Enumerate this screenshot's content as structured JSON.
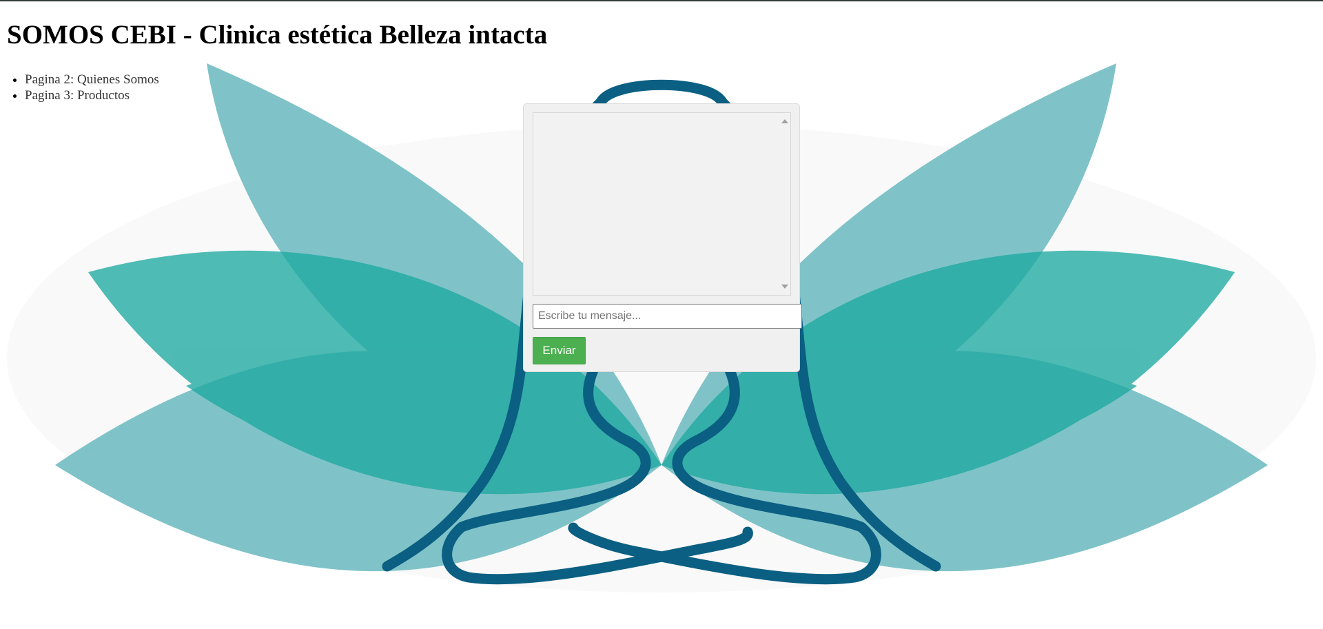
{
  "header": {
    "title": "SOMOS CEBI - Clinica estética Belleza intacta"
  },
  "nav": {
    "items": [
      {
        "label": "Pagina 2: Quienes Somos"
      },
      {
        "label": "Pagina 3: Productos"
      }
    ]
  },
  "chat": {
    "log_text": "",
    "input_value": "",
    "input_placeholder": "Escribe tu mensaje...",
    "send_label": "Enviar"
  },
  "background": {
    "logo_icon": "lotus-meditation-logo-icon",
    "colors": {
      "petal_light": "#7fc3c8",
      "petal_mid": "#1ea9a0",
      "figure_line": "#0a5f82",
      "glow": "#f4f4f4",
      "top_rule": "#2f3d3a",
      "send_button": "#4caf50"
    }
  }
}
